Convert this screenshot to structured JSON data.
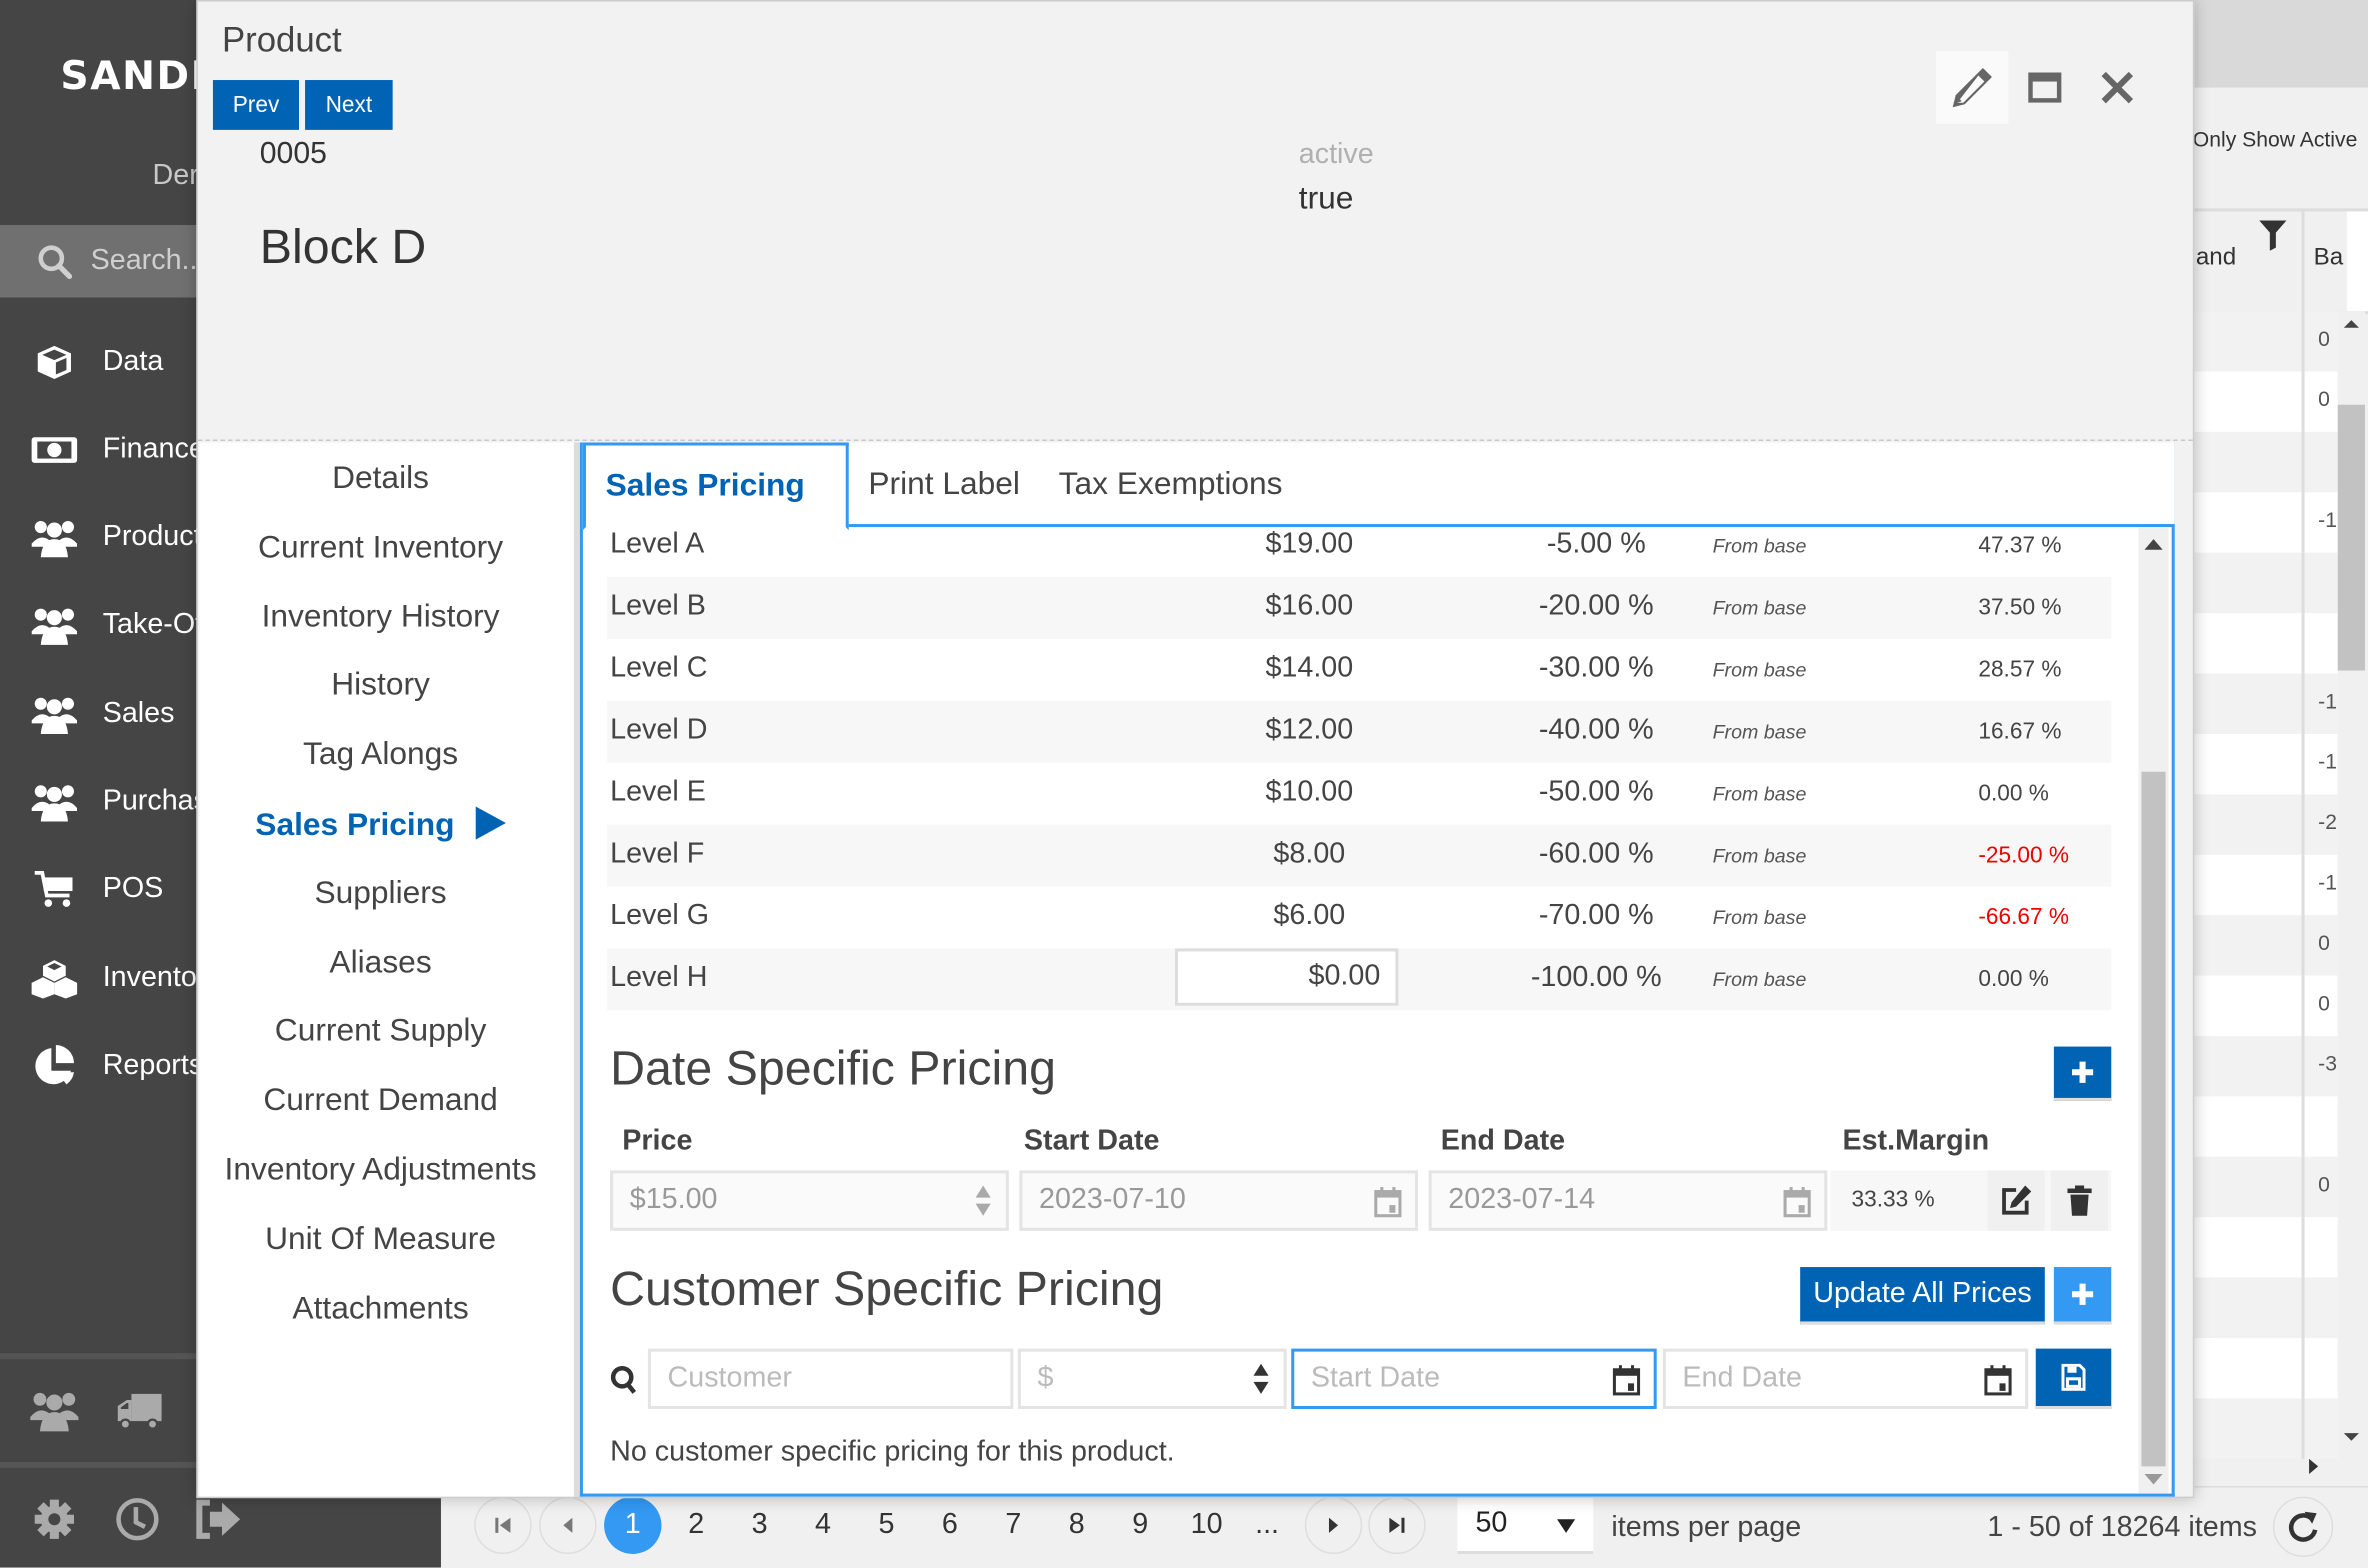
{
  "app": {
    "brand": "SANDI",
    "subtitle": "Der",
    "search_placeholder": "Search...",
    "nav": [
      {
        "label": "Data",
        "icon": "cube-icon"
      },
      {
        "label": "Finance",
        "icon": "money-bill-icon"
      },
      {
        "label": "Product",
        "icon": "users-icon"
      },
      {
        "label": "Take-Of",
        "icon": "users-icon"
      },
      {
        "label": "Sales",
        "icon": "users-icon"
      },
      {
        "label": "Purchas",
        "icon": "users-icon"
      },
      {
        "label": "POS",
        "icon": "cart-icon"
      },
      {
        "label": "Invento",
        "icon": "cubes-icon"
      },
      {
        "label": "Reports",
        "icon": "pie-chart-icon"
      }
    ]
  },
  "background_grid": {
    "filter_label": "Only Show Active",
    "columns": [
      "and",
      "Ba"
    ],
    "values": [
      "0",
      "0",
      "",
      "-1",
      "",
      "",
      "-1",
      "-1",
      "-2",
      "-1",
      "0",
      "0",
      "-3",
      "",
      "0",
      "",
      "",
      "",
      ""
    ]
  },
  "pager": {
    "pages": [
      "1",
      "2",
      "3",
      "4",
      "5",
      "6",
      "7",
      "8",
      "9",
      "10",
      "..."
    ],
    "current_page": "1",
    "page_size": "50",
    "page_size_label": "items per page",
    "info": "1 - 50 of 18264 items"
  },
  "modal": {
    "title": "Product",
    "prev_label": "Prev",
    "next_label": "Next",
    "product_code": "0005",
    "product_name": "Block D",
    "active_label": "active",
    "active_value": "true",
    "nav": [
      {
        "label": "Details"
      },
      {
        "label": "Current Inventory"
      },
      {
        "label": "Inventory History"
      },
      {
        "label": "History"
      },
      {
        "label": "Tag Alongs"
      },
      {
        "label": "Sales Pricing",
        "active": true
      },
      {
        "label": "Suppliers"
      },
      {
        "label": "Aliases"
      },
      {
        "label": "Current Supply"
      },
      {
        "label": "Current Demand"
      },
      {
        "label": "Inventory Adjustments"
      },
      {
        "label": "Unit Of Measure"
      },
      {
        "label": "Attachments"
      }
    ],
    "tabs": [
      "Sales Pricing",
      "Print Label",
      "Tax Exemptions"
    ],
    "price_levels": [
      {
        "name": "Level A",
        "price": "$19.00",
        "pct": "-5.00 %",
        "basis": "From base",
        "margin": "47.37 %",
        "negative": false
      },
      {
        "name": "Level B",
        "price": "$16.00",
        "pct": "-20.00 %",
        "basis": "From base",
        "margin": "37.50 %",
        "negative": false
      },
      {
        "name": "Level C",
        "price": "$14.00",
        "pct": "-30.00 %",
        "basis": "From base",
        "margin": "28.57 %",
        "negative": false
      },
      {
        "name": "Level D",
        "price": "$12.00",
        "pct": "-40.00 %",
        "basis": "From base",
        "margin": "16.67 %",
        "negative": false
      },
      {
        "name": "Level E",
        "price": "$10.00",
        "pct": "-50.00 %",
        "basis": "From base",
        "margin": "0.00 %",
        "negative": false
      },
      {
        "name": "Level F",
        "price": "$8.00",
        "pct": "-60.00 %",
        "basis": "From base",
        "margin": "-25.00 %",
        "negative": true
      },
      {
        "name": "Level G",
        "price": "$6.00",
        "pct": "-70.00 %",
        "basis": "From base",
        "margin": "-66.67 %",
        "negative": true
      },
      {
        "name": "Level H",
        "price": "$0.00",
        "pct": "-100.00 %",
        "basis": "From base",
        "margin": "0.00 %",
        "negative": false,
        "editing": true
      }
    ],
    "date_pricing": {
      "title": "Date Specific Pricing",
      "headers": {
        "price": "Price",
        "start": "Start Date",
        "end": "End Date",
        "margin": "Est.Margin"
      },
      "rows": [
        {
          "price": "$15.00",
          "start": "2023-07-10",
          "end": "2023-07-14",
          "margin": "33.33 %"
        }
      ]
    },
    "customer_pricing": {
      "title": "Customer Specific Pricing",
      "update_all_label": "Update All Prices",
      "customer_placeholder": "Customer",
      "price_placeholder": "$",
      "start_placeholder": "Start Date",
      "end_placeholder": "End Date",
      "empty_message": "No customer specific pricing for this product."
    }
  },
  "colors": {
    "primary": "#0063b4",
    "accent": "#3399f3",
    "negative": "#e00000",
    "sidebar": "#454545"
  }
}
